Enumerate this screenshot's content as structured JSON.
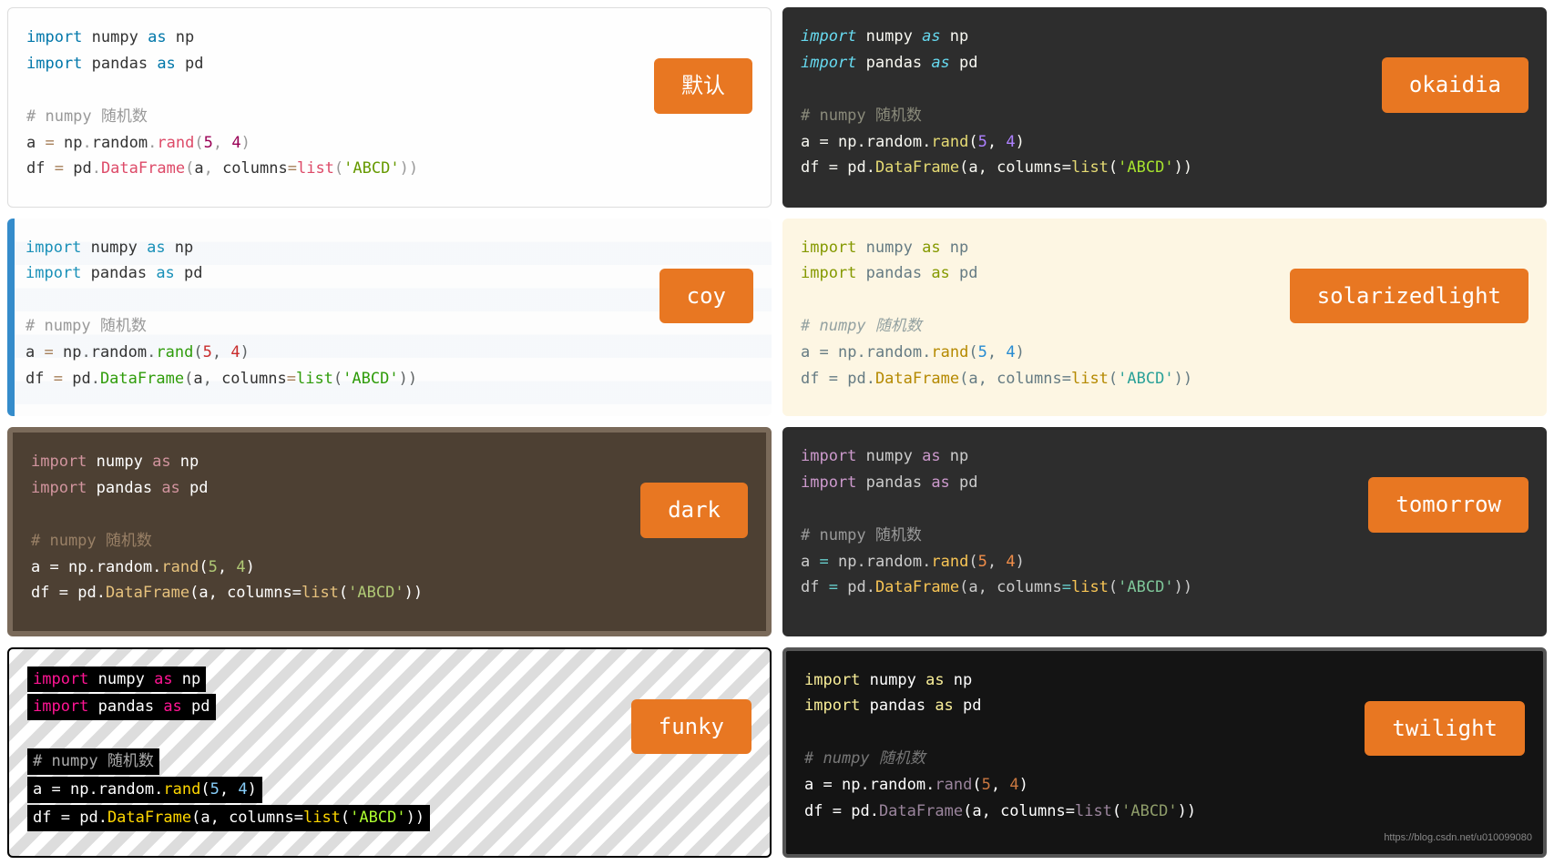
{
  "themes": {
    "default": {
      "label": "默认"
    },
    "okaidia": {
      "label": "okaidia"
    },
    "coy": {
      "label": "coy"
    },
    "solarizedlight": {
      "label": "solarizedlight"
    },
    "dark": {
      "label": "dark"
    },
    "tomorrow": {
      "label": "tomorrow"
    },
    "funky": {
      "label": "funky"
    },
    "twilight": {
      "label": "twilight"
    }
  },
  "code": {
    "line1_import": "import",
    "line1_numpy": " numpy ",
    "line1_as": "as",
    "line1_np": " np",
    "line2_import": "import",
    "line2_pandas": " pandas ",
    "line2_as": "as",
    "line2_pd": " pd",
    "line3_comment": "# numpy 随机数",
    "line4_a": "a ",
    "line4_eq": "=",
    "line4_np": " np",
    "line4_dot1": ".",
    "line4_random": "random",
    "line4_dot2": ".",
    "line4_rand": "rand",
    "line4_lparen": "(",
    "line4_5": "5",
    "line4_comma": ",",
    "line4_sp": " ",
    "line4_4": "4",
    "line4_rparen": ")",
    "line5_df": "df ",
    "line5_eq": "=",
    "line5_pd": " pd",
    "line5_dot1": ".",
    "line5_DataFrame": "DataFrame",
    "line5_lparen": "(",
    "line5_a": "a",
    "line5_comma": ",",
    "line5_sp": " ",
    "line5_columns": "columns",
    "line5_eq2": "=",
    "line5_list": "list",
    "line5_lparen2": "(",
    "line5_str": "'ABCD'",
    "line5_rparen2": ")",
    "line5_rparen": ")"
  },
  "watermark": "https://blog.csdn.net/u010099080"
}
